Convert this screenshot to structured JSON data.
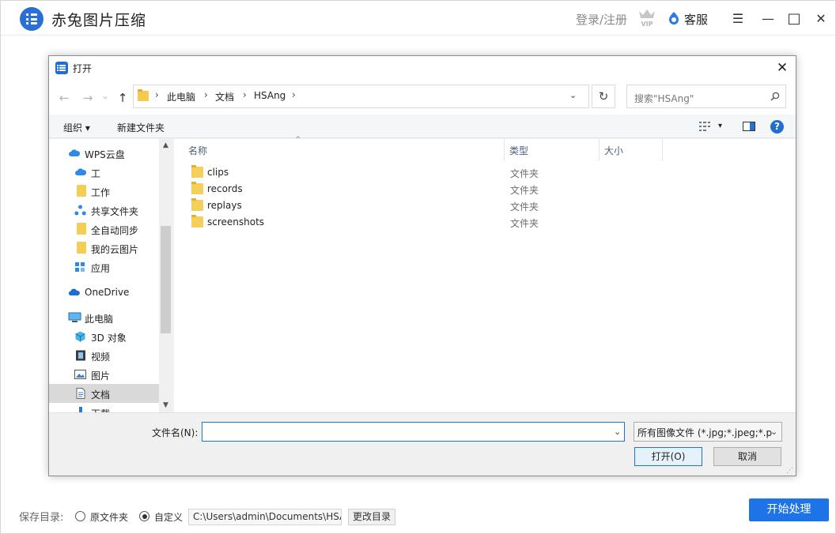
{
  "app": {
    "title": "赤兔图片压缩",
    "login_label": "登录/注册",
    "vip_label": "VIP",
    "service_label": "客服",
    "menu_glyph": "☰",
    "minimize_glyph": "—",
    "maximize_glyph": "□",
    "close_glyph": "✕",
    "accent_color": "#1e74e6"
  },
  "save": {
    "label": "保存目录:",
    "option_original": "原文件夹",
    "option_custom": "自定义",
    "selected": "自定义",
    "path": "C:\\Users\\admin\\Documents\\HSAng",
    "change_button": "更改目录",
    "start_button": "开始处理"
  },
  "dialog": {
    "title": "打开",
    "close_glyph": "✕",
    "nav": {
      "back_glyph": "←",
      "forward_glyph": "→",
      "dropdown_glyph": "⌄",
      "up_glyph": "↑",
      "breadcrumbs": [
        "此电脑",
        "文档",
        "HSAng"
      ],
      "separator": "›",
      "address_dropdown_glyph": "⌄",
      "refresh_glyph": "↻",
      "search_placeholder": "搜索\"HSAng\""
    },
    "toolbar": {
      "organize": "组织 ▾",
      "new_folder": "新建文件夹",
      "view_dropdown_glyph": "▾",
      "help_glyph": "?"
    },
    "navpane": {
      "items": [
        {
          "label": "WPS云盘",
          "icon": "cloud-icon",
          "indent": 0
        },
        {
          "label": "工",
          "icon": "cloud-icon",
          "indent": 1
        },
        {
          "label": "工作",
          "icon": "folder-icon",
          "indent": 1
        },
        {
          "label": "共享文件夹",
          "icon": "share-icon",
          "indent": 1
        },
        {
          "label": "全自动同步",
          "icon": "folder-icon",
          "indent": 1
        },
        {
          "label": "我的云图片",
          "icon": "folder-icon",
          "indent": 1
        },
        {
          "label": "应用",
          "icon": "apps-icon",
          "indent": 1
        },
        {
          "label": "OneDrive",
          "icon": "onedrive-icon",
          "indent": 0
        },
        {
          "label": "此电脑",
          "icon": "computer-icon",
          "indent": 0
        },
        {
          "label": "3D 对象",
          "icon": "cube-icon",
          "indent": 1
        },
        {
          "label": "视频",
          "icon": "video-icon",
          "indent": 1
        },
        {
          "label": "图片",
          "icon": "picture-icon",
          "indent": 1
        },
        {
          "label": "文档",
          "icon": "document-icon",
          "indent": 1,
          "selected": true
        },
        {
          "label": "下载",
          "icon": "download-icon",
          "indent": 1
        }
      ],
      "scroll_up_glyph": "▲",
      "scroll_down_glyph": "▼"
    },
    "columns": {
      "name": "名称",
      "type": "类型",
      "size": "大小",
      "sort_glyph": "^"
    },
    "files": [
      {
        "name": "clips",
        "type": "文件夹"
      },
      {
        "name": "records",
        "type": "文件夹"
      },
      {
        "name": "replays",
        "type": "文件夹"
      },
      {
        "name": "screenshots",
        "type": "文件夹"
      }
    ],
    "bottom": {
      "filename_label": "文件名(N):",
      "filename_value": "",
      "filename_dropdown_glyph": "⌄",
      "filter": "所有图像文件 (*.jpg;*.jpeg;*.p",
      "filter_dropdown_glyph": "⌄",
      "open_button": "打开(O)",
      "cancel_button": "取消",
      "grip_glyph": "⋰"
    }
  }
}
